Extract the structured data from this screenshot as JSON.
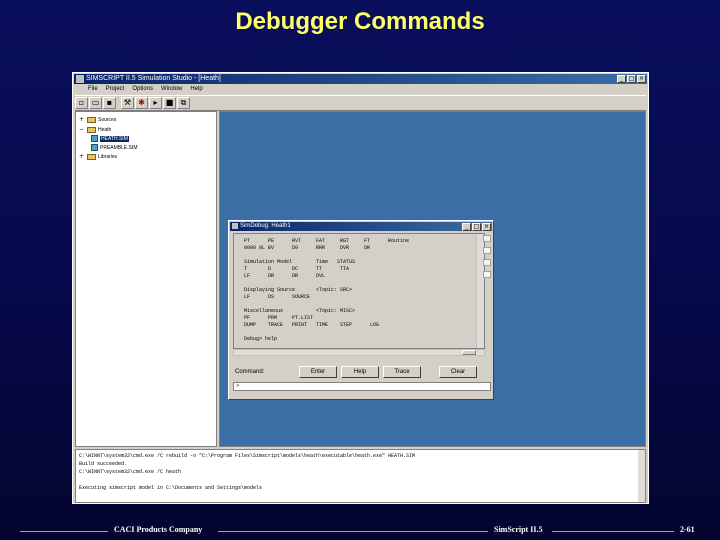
{
  "slide": {
    "title": "Debugger Commands"
  },
  "app": {
    "window_title": "SIMSCRIPT II.5 Simulation Studio - [Heath]",
    "menu": [
      "File",
      "Project",
      "Options",
      "Window",
      "Help"
    ],
    "toolbar_icons": [
      "new-icon",
      "open-icon",
      "save-icon",
      "build-icon",
      "debug-icon",
      "run-icon",
      "stop-icon",
      "window-icon"
    ],
    "tree": [
      {
        "label": "Sources",
        "indent": 0,
        "icon": "folder"
      },
      {
        "label": "Heath",
        "indent": 0,
        "icon": "folder"
      },
      {
        "label": "HEATH.SIM",
        "indent": 2,
        "icon": "doc",
        "selected": true
      },
      {
        "label": "PREAMBLE.SIM",
        "indent": 2,
        "icon": "doc"
      },
      {
        "label": "Libraries",
        "indent": 0,
        "icon": "folder"
      }
    ],
    "console_lines": [
      "C:\\WINNT\\system32\\cmd.exe /C rebuild -o \"C:\\Program Files\\Simscript\\models\\heath\\executable\\heath.exe\" HEATH.SIM",
      "Build succeeded.",
      "C:\\WINNT\\system32\\cmd.exe /C heath",
      "",
      "Executing simscript model in C:\\Documents and Settings\\models"
    ]
  },
  "debug_window": {
    "title": "SimDebug: Heath1",
    "output_lines": [
      "  PT      PE      RVT     FAT     RGT     FT      Routine",
      "  0000 0L BV      D0      RRR     DVR     DR",
      "",
      "  Simulation Model        Time   STATUS",
      "  T       D       DC      TT      TTA",
      "  LF      DR      DR      DVL",
      "",
      "  Displaying Source       <Topic: SRC>",
      "  LF      DS      SOURCE",
      "",
      "  Miscellaneous           <Topic: MISC>",
      "  PF      PRM     PT.LIST",
      "  DUMP    TRACE   PRINT   TIME    STEP      LOG",
      "",
      "  Debug> help"
    ],
    "command_label": "Command:",
    "buttons": [
      "Enter",
      "Help",
      "Trace",
      "Clear"
    ],
    "command_value": ">"
  },
  "footer": {
    "left": "CACI Products Company",
    "center": "SimScript II.5",
    "right": "2-61"
  }
}
